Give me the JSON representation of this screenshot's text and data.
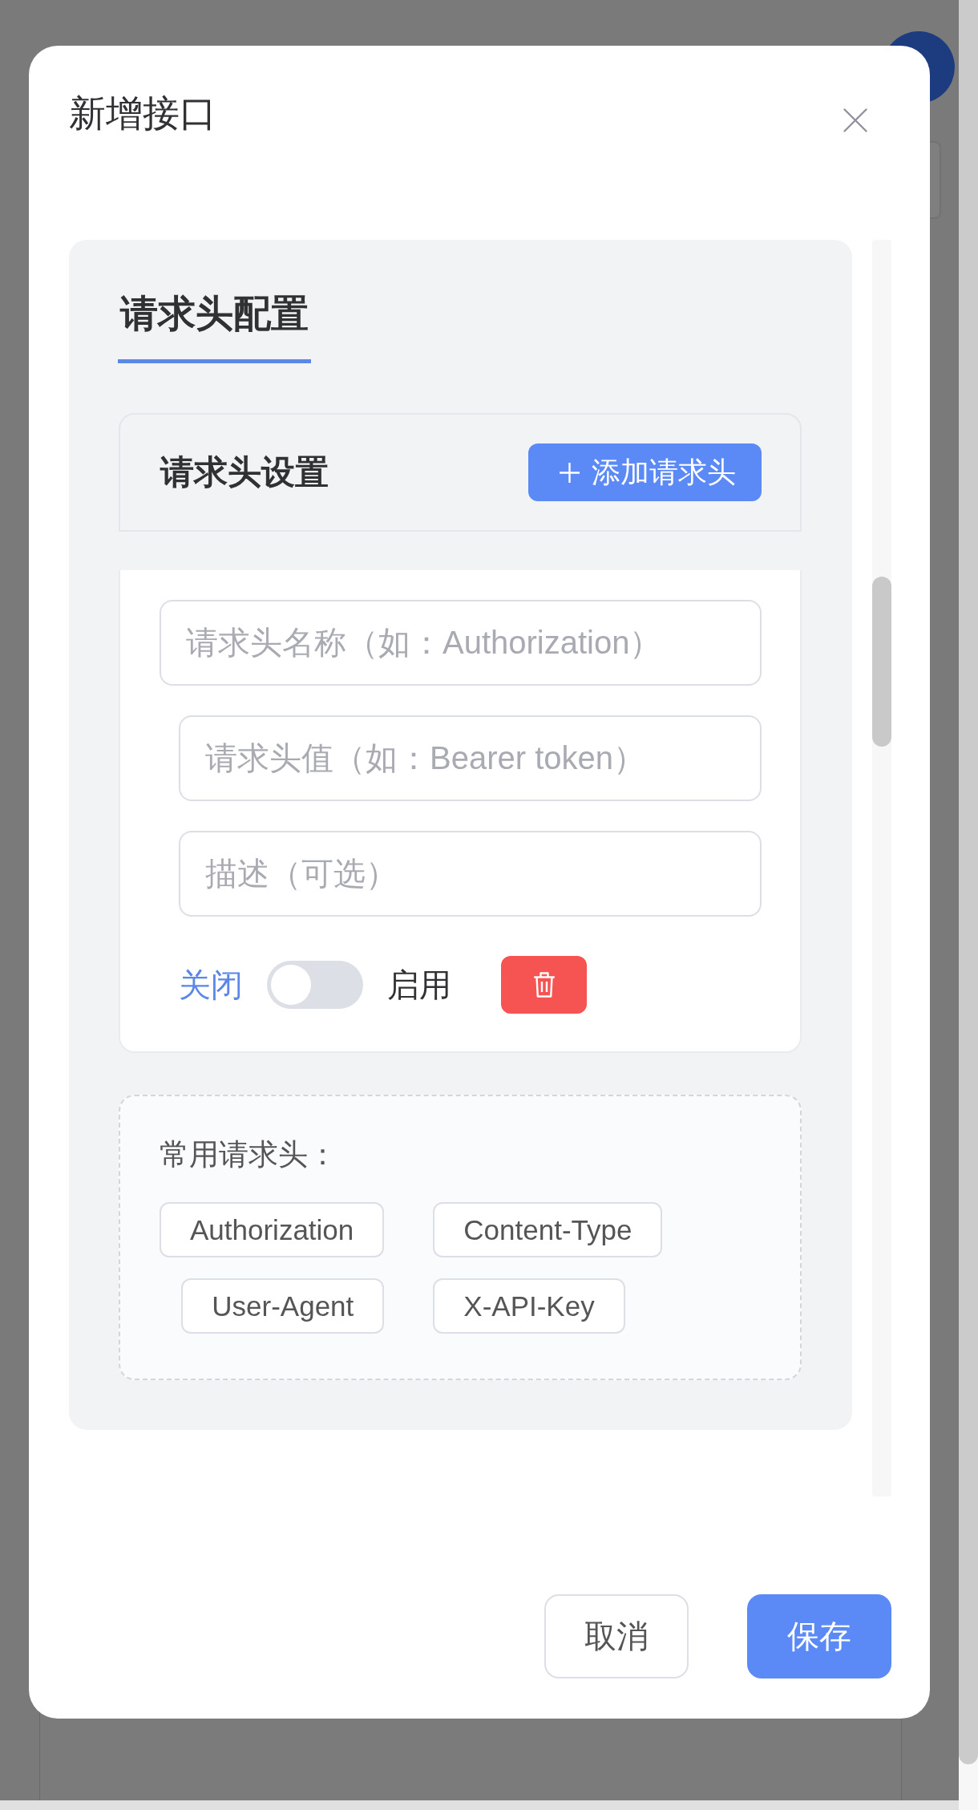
{
  "dialog": {
    "title": "新增接口"
  },
  "tabs": [
    {
      "label": "请求头配置",
      "selected": true
    }
  ],
  "header_settings": {
    "title": "请求头设置",
    "add_button": "添加请求头"
  },
  "headers": [
    {
      "fields": [
        {
          "placeholder": "请求头名称（如：Authorization）"
        },
        {
          "placeholder": "请求头值（如：Bearer token）"
        },
        {
          "placeholder": "描述（可选）"
        }
      ],
      "off_label": "关闭",
      "on_label": "启用",
      "enabled": false
    }
  ],
  "common_headers": {
    "label": "常用请求头：",
    "tags": [
      "Authorization",
      "Content-Type",
      "User-Agent",
      "X-API-Key"
    ]
  },
  "footer": {
    "buttons": [
      {
        "label": "取消",
        "kind": "secondary"
      },
      {
        "label": "保存",
        "kind": "primary"
      }
    ]
  }
}
